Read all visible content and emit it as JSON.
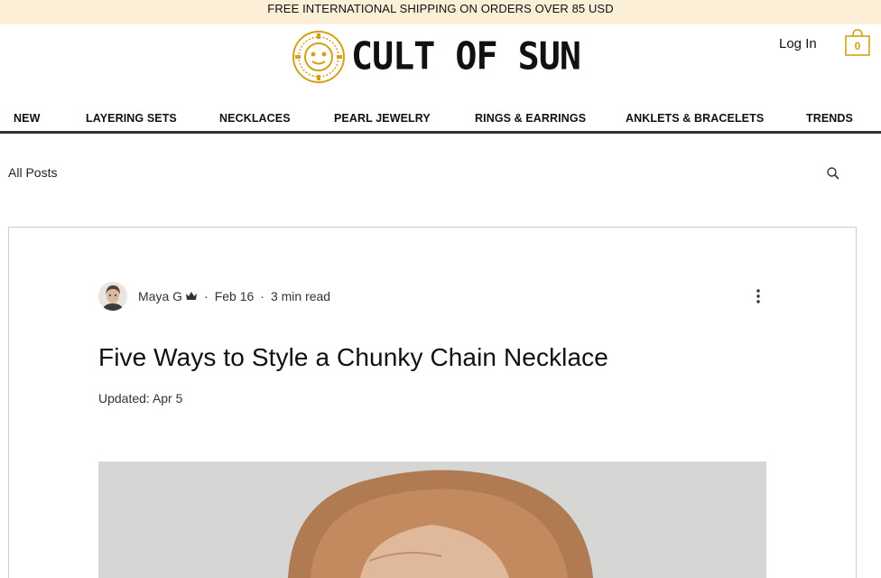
{
  "promo": {
    "text": "FREE INTERNATIONAL SHIPPING ON ORDERS OVER 85 USD"
  },
  "brand": {
    "name": "CULT OF SUN",
    "logo_icon": "sun-medallion-icon",
    "gold": "#d4a017"
  },
  "header": {
    "login_label": "Log In",
    "cart_count": "0",
    "cart_icon": "shopping-bag-icon"
  },
  "nav": {
    "items": [
      {
        "label": "NEW"
      },
      {
        "label": "LAYERING SETS"
      },
      {
        "label": "NECKLACES"
      },
      {
        "label": "PEARL JEWELRY"
      },
      {
        "label": "RINGS & EARRINGS"
      },
      {
        "label": "ANKLETS & BRACELETS"
      },
      {
        "label": "TRENDS"
      }
    ]
  },
  "blog": {
    "all_posts_label": "All Posts",
    "search_icon": "search-icon"
  },
  "post": {
    "author": "Maya G",
    "author_role_icon": "crown-icon",
    "date": "Feb 16",
    "read_time": "3 min read",
    "title": "Five Ways to Style a Chunky Chain Necklace",
    "updated": "Updated: Apr 5",
    "more_icon": "more-actions-icon",
    "separator": "·"
  },
  "colors": {
    "promo_bg": "#fbefd7",
    "nav_rule": "#333333",
    "card_border": "#cfcfcf"
  }
}
